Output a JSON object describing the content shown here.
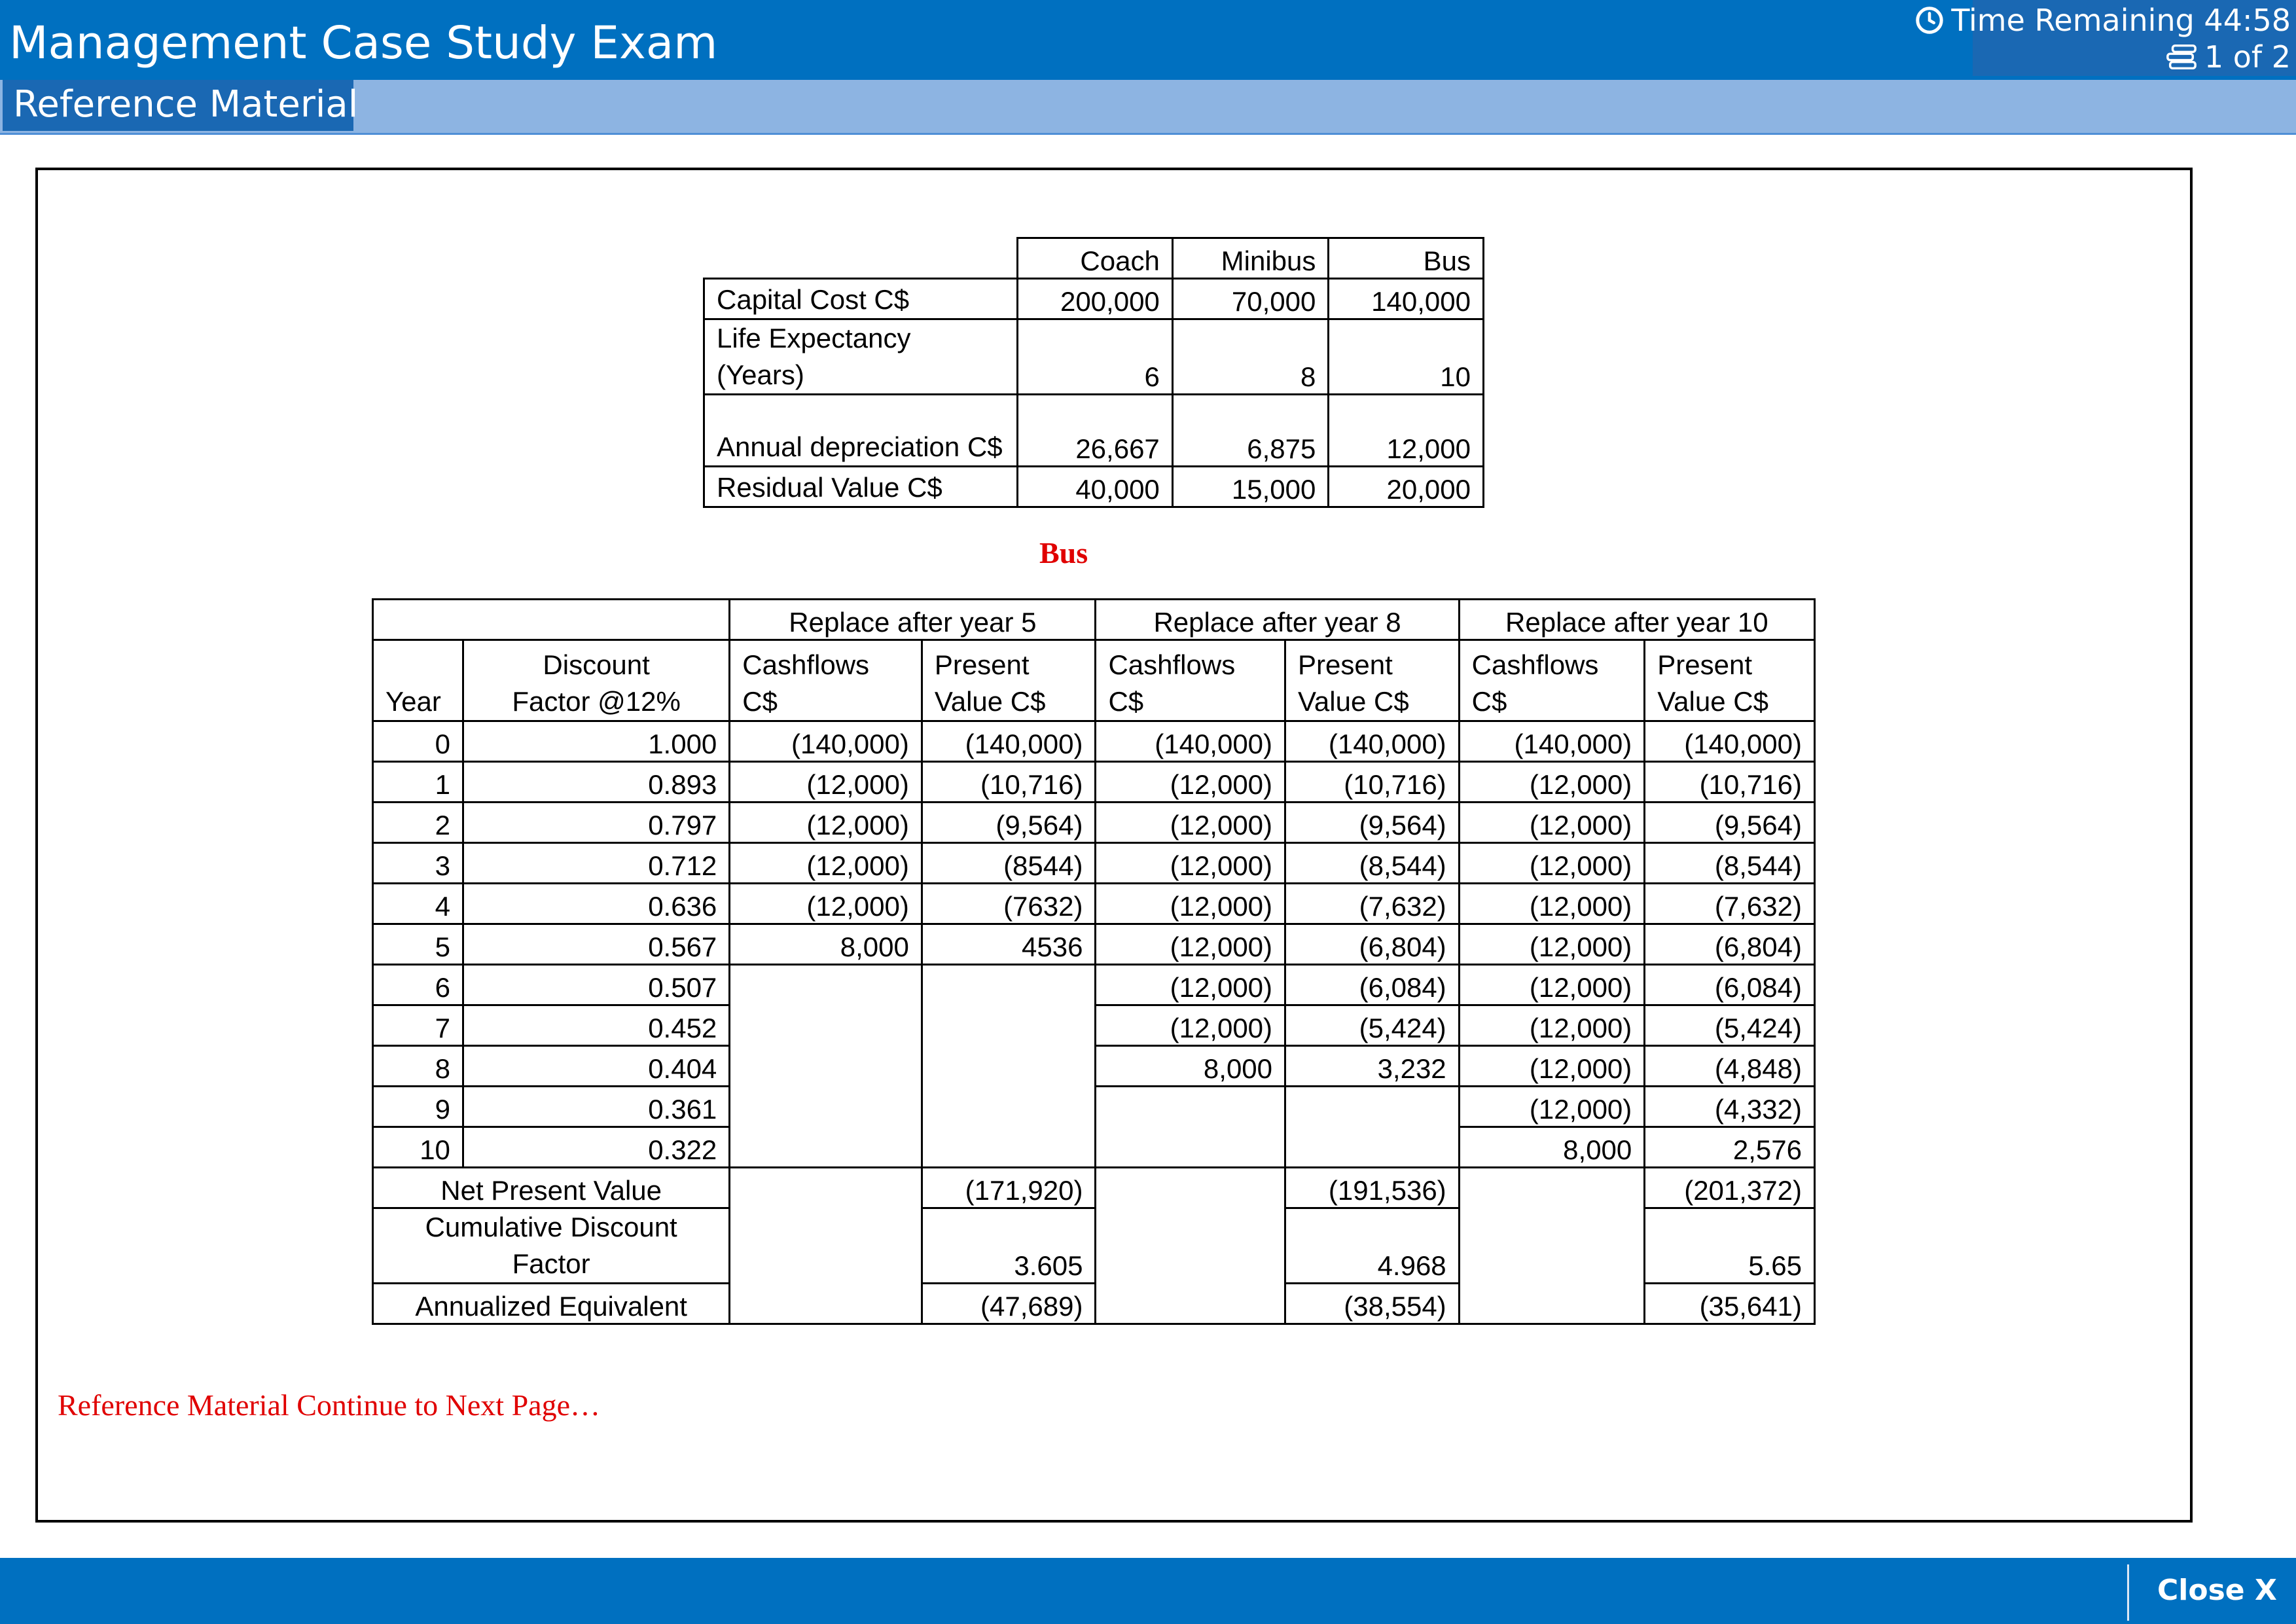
{
  "header": {
    "title": "Management Case Study Exam",
    "timer_text": "Time Remaining 44:58",
    "page_indicator": "1 of 2",
    "tab_label": "Reference Material",
    "colors": {
      "bar": "#0070c0",
      "tab": "#1a68b3",
      "subbar": "#8db4e2"
    },
    "icons": [
      "clock-icon",
      "pages-icon"
    ]
  },
  "vehicle_table": {
    "columns": [
      "Coach",
      "Minibus",
      "Bus"
    ],
    "rows": [
      {
        "label": "Capital Cost C$",
        "values": [
          "200,000",
          "70,000",
          "140,000"
        ]
      },
      {
        "label": "Life Expectancy (Years)",
        "values": [
          "6",
          "8",
          "10"
        ]
      },
      {
        "label": "Annual depreciation C$",
        "values": [
          "26,667",
          "6,875",
          "12,000"
        ]
      },
      {
        "label": "Residual Value C$",
        "values": [
          "40,000",
          "15,000",
          "20,000"
        ]
      }
    ]
  },
  "bus_section": {
    "title": "Bus",
    "groups": [
      "Replace after year 5",
      "Replace after year 8",
      "Replace after year 10"
    ],
    "col_year": "Year",
    "col_discount": "Discount Factor @12%",
    "col_cf5": "Cashflows C$",
    "col_pv5": "Present Value C$",
    "col_cf8": "Cashflows C$",
    "col_pv8": "Present Value C$",
    "col_cf10": "Cashflows C$",
    "col_pv10": "Present Value C$",
    "rows": [
      {
        "year": "0",
        "df": "1.000",
        "cf5": "(140,000)",
        "pv5": "(140,000)",
        "cf8": "(140,000)",
        "pv8": "(140,000)",
        "cf10": "(140,000)",
        "pv10": "(140,000)"
      },
      {
        "year": "1",
        "df": "0.893",
        "cf5": "(12,000)",
        "pv5": "(10,716)",
        "cf8": "(12,000)",
        "pv8": "(10,716)",
        "cf10": "(12,000)",
        "pv10": "(10,716)"
      },
      {
        "year": "2",
        "df": "0.797",
        "cf5": "(12,000)",
        "pv5": "(9,564)",
        "cf8": "(12,000)",
        "pv8": "(9,564)",
        "cf10": "(12,000)",
        "pv10": "(9,564)"
      },
      {
        "year": "3",
        "df": "0.712",
        "cf5": "(12,000)",
        "pv5": "(8544)",
        "cf8": "(12,000)",
        "pv8": "(8,544)",
        "cf10": "(12,000)",
        "pv10": "(8,544)"
      },
      {
        "year": "4",
        "df": "0.636",
        "cf5": "(12,000)",
        "pv5": "(7632)",
        "cf8": "(12,000)",
        "pv8": "(7,632)",
        "cf10": "(12,000)",
        "pv10": "(7,632)"
      },
      {
        "year": "5",
        "df": "0.567",
        "cf5": "8,000",
        "pv5": "4536",
        "cf8": "(12,000)",
        "pv8": "(6,804)",
        "cf10": "(12,000)",
        "pv10": "(6,804)"
      },
      {
        "year": "6",
        "df": "0.507",
        "cf5": "",
        "pv5": "",
        "cf8": "(12,000)",
        "pv8": "(6,084)",
        "cf10": "(12,000)",
        "pv10": "(6,084)"
      },
      {
        "year": "7",
        "df": "0.452",
        "cf5": "",
        "pv5": "",
        "cf8": "(12,000)",
        "pv8": "(5,424)",
        "cf10": "(12,000)",
        "pv10": "(5,424)"
      },
      {
        "year": "8",
        "df": "0.404",
        "cf5": "",
        "pv5": "",
        "cf8": "8,000",
        "pv8": "3,232",
        "cf10": "(12,000)",
        "pv10": "(4,848)"
      },
      {
        "year": "9",
        "df": "0.361",
        "cf5": "",
        "pv5": "",
        "cf8": "",
        "pv8": "",
        "cf10": "(12,000)",
        "pv10": "(4,332)"
      },
      {
        "year": "10",
        "df": "0.322",
        "cf5": "",
        "pv5": "",
        "cf8": "",
        "pv8": "",
        "cf10": "8,000",
        "pv10": "2,576"
      }
    ],
    "summary": [
      {
        "label": "Net Present Value",
        "pv5": "(171,920)",
        "pv8": "(191,536)",
        "pv10": "(201,372)"
      },
      {
        "label": "Cumulative Discount Factor",
        "pv5": "3.605",
        "pv8": "4.968",
        "pv10": "5.65"
      },
      {
        "label": "Annualized Equivalent",
        "pv5": "(47,689)",
        "pv8": "(38,554)",
        "pv10": "(35,641)"
      }
    ]
  },
  "note": "Reference Material Continue to Next Page…",
  "footer": {
    "close_label": "Close X"
  }
}
